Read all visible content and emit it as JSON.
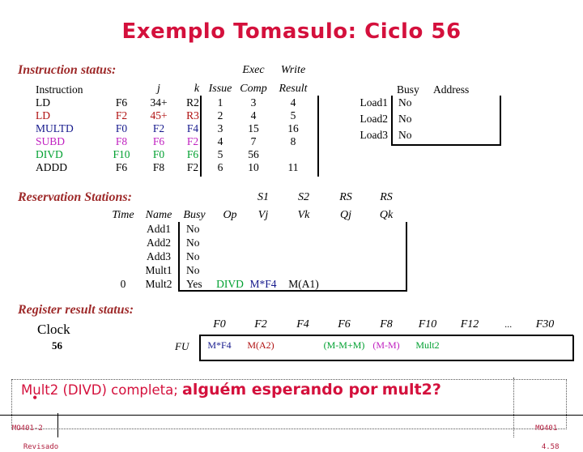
{
  "title": "Exemplo Tomasulo: Ciclo 56",
  "colors": {
    "title": "#d4103c",
    "heading": "#9e2a2a",
    "black": "#000000",
    "red": "#b01010",
    "blue": "#15198c",
    "magenta": "#c020c0",
    "green": "#00a030"
  },
  "instruction_status": {
    "heading": "Instruction status:",
    "headers_upper": [
      "Exec",
      "Write"
    ],
    "headers": [
      "Instruction",
      "j",
      "k",
      "Issue",
      "Comp",
      "Result"
    ],
    "rows": [
      {
        "instruction": "LD",
        "dest": "F6",
        "j": "34+",
        "k": "R2",
        "issue": "1",
        "comp": "3",
        "result": "4",
        "color": "black"
      },
      {
        "instruction": "LD",
        "dest": "F2",
        "j": "45+",
        "k": "R3",
        "issue": "2",
        "comp": "4",
        "result": "5",
        "color": "red"
      },
      {
        "instruction": "MULTD",
        "dest": "F0",
        "j": "F2",
        "k": "F4",
        "issue": "3",
        "comp": "15",
        "result": "16",
        "color": "blue"
      },
      {
        "instruction": "SUBD",
        "dest": "F8",
        "j": "F6",
        "k": "F2",
        "issue": "4",
        "comp": "7",
        "result": "8",
        "color": "magenta"
      },
      {
        "instruction": "DIVD",
        "dest": "F10",
        "j": "F0",
        "k": "F6",
        "issue": "5",
        "comp": "56",
        "result": "",
        "color": "green"
      },
      {
        "instruction": "ADDD",
        "dest": "F6",
        "j": "F8",
        "k": "F2",
        "issue": "6",
        "comp": "10",
        "result": "11",
        "color": "black"
      }
    ]
  },
  "load_buffers": {
    "headers": [
      "Busy",
      "Address"
    ],
    "rows": [
      {
        "name": "Load1",
        "busy": "No",
        "address": ""
      },
      {
        "name": "Load2",
        "busy": "No",
        "address": ""
      },
      {
        "name": "Load3",
        "busy": "No",
        "address": ""
      }
    ]
  },
  "reservation_stations": {
    "heading": "Reservation Stations:",
    "headers_upper": [
      "S1",
      "S2",
      "RS",
      "RS"
    ],
    "headers": [
      "Time",
      "Name",
      "Busy",
      "Op",
      "Vj",
      "Vk",
      "Qj",
      "Qk"
    ],
    "rows": [
      {
        "time": "",
        "name": "Add1",
        "busy": "No",
        "op": "",
        "vj": "",
        "vk": "",
        "qj": "",
        "qk": "",
        "op_color": "black",
        "vj_color": "black",
        "vk_color": "black"
      },
      {
        "time": "",
        "name": "Add2",
        "busy": "No",
        "op": "",
        "vj": "",
        "vk": "",
        "qj": "",
        "qk": "",
        "op_color": "black",
        "vj_color": "black",
        "vk_color": "black"
      },
      {
        "time": "",
        "name": "Add3",
        "busy": "No",
        "op": "",
        "vj": "",
        "vk": "",
        "qj": "",
        "qk": "",
        "op_color": "black",
        "vj_color": "black",
        "vk_color": "black"
      },
      {
        "time": "",
        "name": "Mult1",
        "busy": "No",
        "op": "",
        "vj": "",
        "vk": "",
        "qj": "",
        "qk": "",
        "op_color": "black",
        "vj_color": "black",
        "vk_color": "black"
      },
      {
        "time": "0",
        "name": "Mult2",
        "busy": "Yes",
        "op": "DIVD",
        "vj": "M*F4",
        "vk": "M(A1)",
        "qj": "",
        "qk": "",
        "op_color": "green",
        "vj_color": "blue",
        "vk_color": "black"
      }
    ]
  },
  "register_result_status": {
    "heading": "Register result status:",
    "clock_label": "Clock",
    "clock_value": "56",
    "fu_label": "FU",
    "registers": [
      "F0",
      "F2",
      "F4",
      "F6",
      "F8",
      "F10",
      "F12",
      "...",
      "F30"
    ],
    "values": [
      {
        "reg": "F0",
        "value": "M*F4",
        "color": "blue"
      },
      {
        "reg": "F2",
        "value": "M(A2)",
        "color": "red"
      },
      {
        "reg": "F4",
        "value": "",
        "color": "black"
      },
      {
        "reg": "F6",
        "value": "(M-M+M)",
        "color": "green"
      },
      {
        "reg": "F8",
        "value": "(M-M)",
        "color": "magenta"
      },
      {
        "reg": "F10",
        "value": "Mult2",
        "color": "green"
      },
      {
        "reg": "F12",
        "value": "",
        "color": "black"
      },
      {
        "reg": "...",
        "value": "",
        "color": "black"
      },
      {
        "reg": "F30",
        "value": "",
        "color": "black"
      }
    ]
  },
  "bullet": {
    "marker": "•",
    "line1_small": "Mult2 (DIVD) completa;",
    "line1_big": "alguém esperando por",
    "line2_big": "mult2?"
  },
  "footer": {
    "left_line1": "MO401-2",
    "left_line2": "Revisado",
    "right_line1": "MO401",
    "right_line2": "4.58"
  }
}
